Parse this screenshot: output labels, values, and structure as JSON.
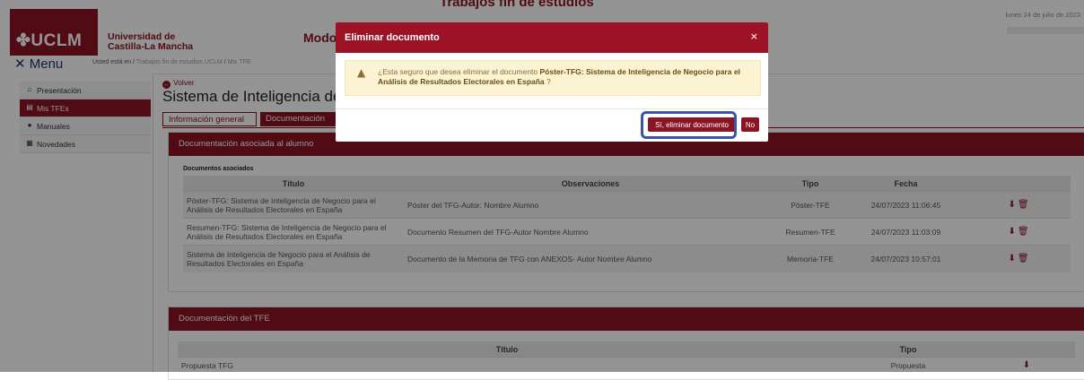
{
  "header": {
    "logo_text": "✤UCLM",
    "university_line1": "Universidad de",
    "university_line2": "Castilla-La Mancha",
    "app_title": "Trabajos fin de estudios",
    "mode_label": "Modo",
    "date": "lunes 24 de julio de 2023"
  },
  "nav": {
    "menu_label": "✕ Menu",
    "breadcrumb_prefix": "Usted está en /",
    "breadcrumb_1": "Trabajos fin de estudios UCLM",
    "breadcrumb_sep": "/",
    "breadcrumb_2": "Mis TFE"
  },
  "sidebar": {
    "items": [
      {
        "label": "Presentación",
        "icon": "home-icon"
      },
      {
        "label": "Mis TFEs",
        "icon": "file-icon"
      },
      {
        "label": "Manuales",
        "icon": "info-icon"
      },
      {
        "label": "Novedades",
        "icon": "news-icon"
      }
    ]
  },
  "main": {
    "back_label": "Volver",
    "title": "Sistema de Inteligencia de Negocio para el Análisis de Resultados Electorales en España",
    "tabs": [
      "Información general",
      "Documentación"
    ]
  },
  "panel_student": {
    "title": "Documentación asociada al alumno",
    "subtitle": "Documentos asociados",
    "columns": [
      "Título",
      "Observaciones",
      "Tipo",
      "Fecha",
      ""
    ],
    "rows": [
      {
        "titulo": "Póster-TFG: Sistema de Inteligencia de Negocio para el Análisis de Resultados Electorales en España",
        "obs": "Póster del TFG-Autor: Nombre Alumno",
        "tipo": "Póster-TFE",
        "fecha": "24/07/2023 11:06:45"
      },
      {
        "titulo": "Resumen-TFG: Sistema de Inteligencia de Negocio para el Análisis de Resultados Electorales en España",
        "obs": "Documento Resumen del TFG-Autor Nombre Alumno",
        "tipo": "Resumen-TFE",
        "fecha": "24/07/2023 11:03:09"
      },
      {
        "titulo": "Sistema de Inteligencia de Negocio para el Análisis de Resultados Electorales en España",
        "obs": "Documento de la Memoria de TFG con ANEXOS- Autor Nombre Alumno",
        "tipo": "Memoria-TFE",
        "fecha": "24/07/2023 10:57:01"
      }
    ]
  },
  "panel_tfe": {
    "title": "Documentación del TFE",
    "columns": [
      "Título",
      "Tipo",
      ""
    ],
    "rows": [
      {
        "titulo": "Propuesta TFG",
        "tipo": "Propuesta"
      }
    ]
  },
  "modal": {
    "title": "Eliminar documento",
    "close": "×",
    "message_prefix": "¿Esta seguro que desea eliminar el documento ",
    "message_doc": "Póster-TFG: Sistema de Inteligencia de Negocio para el Análisis de Resultados Electorales en España",
    "message_suffix": " ?",
    "confirm_label": "Sí, eliminar documento",
    "cancel_label": "No"
  },
  "colors": {
    "brand": "#8b1425",
    "highlight": "#3b55a4"
  }
}
